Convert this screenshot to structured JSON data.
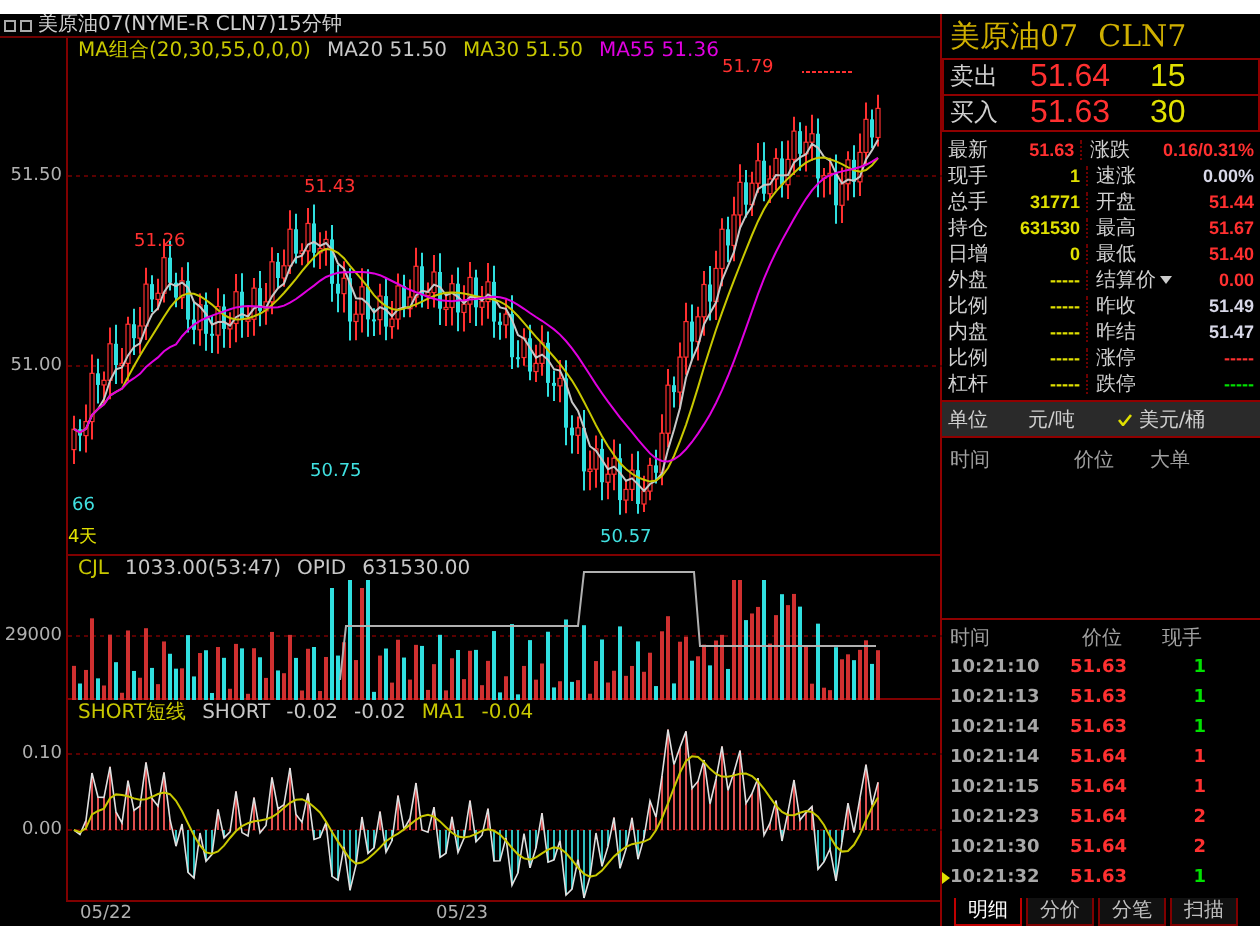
{
  "chart_header": {
    "title": "美原油07(NYME-R CLN7)15分钟"
  },
  "main_chart": {
    "legend": [
      {
        "text": "MA组合(20,30,55,0,0,0)",
        "color": "#c8c800"
      },
      {
        "text": "MA20 51.50",
        "color": "#c8c8c8"
      },
      {
        "text": "MA30 51.50",
        "color": "#c8c800"
      },
      {
        "text": "MA55 51.36",
        "color": "#e000e0"
      }
    ],
    "y_labels": [
      "51.50",
      "51.00"
    ],
    "price_marks": [
      {
        "text": "51.79",
        "color": "#ff3030"
      },
      {
        "text": "51.43",
        "color": "#ff3030"
      },
      {
        "text": "51.26",
        "color": "#ff3030"
      },
      {
        "text": "50.75",
        "color": "#40e0e0"
      },
      {
        "text": "50.57",
        "color": "#40e0e0"
      }
    ],
    "corner_labels": [
      {
        "text": "66",
        "color": "#40e0e0"
      },
      {
        "text": "4天",
        "color": "#e0e000"
      }
    ]
  },
  "volume_panel": {
    "legend": [
      {
        "text": "CJL",
        "color": "#c8c800"
      },
      {
        "text": "1033.00(53:47)",
        "color": "#c8c8c8"
      },
      {
        "text": "OPID",
        "color": "#c8c8c8"
      },
      {
        "text": "631530.00",
        "color": "#c8c8c8"
      }
    ],
    "y_labels": [
      "29000"
    ]
  },
  "short_panel": {
    "legend": [
      {
        "text": "SHORT短线",
        "color": "#c8c800"
      },
      {
        "text": "SHORT",
        "color": "#c8c8c8"
      },
      {
        "text": "-0.02",
        "color": "#c8c8c8"
      },
      {
        "text": "-0.02",
        "color": "#c8c8c8"
      },
      {
        "text": "MA1",
        "color": "#c8c800"
      },
      {
        "text": "-0.04",
        "color": "#c8c800"
      }
    ],
    "y_labels": [
      "0.10",
      "0.00"
    ]
  },
  "x_labels": [
    "05/22",
    "05/23"
  ],
  "quote": {
    "name": "美原油07",
    "code": "CLN7",
    "book": [
      {
        "label": "卖出",
        "price": "51.64",
        "volume": "15"
      },
      {
        "label": "买入",
        "price": "51.63",
        "volume": "30"
      }
    ],
    "stats": [
      {
        "left": {
          "label": "最新",
          "value": "51.63",
          "color": "#ff3030"
        },
        "right": {
          "label": "涨跌",
          "value": "0.16/0.31%",
          "color": "#ff3030",
          "dropdown": false
        }
      },
      {
        "left": {
          "label": "现手",
          "value": "1",
          "color": "#e0e000"
        },
        "right": {
          "label": "速涨",
          "value": "0.00%",
          "color": "#d8d8e8",
          "dropdown": false
        }
      },
      {
        "left": {
          "label": "总手",
          "value": "31771",
          "color": "#e0e000"
        },
        "right": {
          "label": "开盘",
          "value": "51.44",
          "color": "#ff3030",
          "dropdown": false
        }
      },
      {
        "left": {
          "label": "持仓",
          "value": "631530",
          "color": "#e0e000"
        },
        "right": {
          "label": "最高",
          "value": "51.67",
          "color": "#ff3030",
          "dropdown": false
        }
      },
      {
        "left": {
          "label": "日增",
          "value": "0",
          "color": "#e0e000"
        },
        "right": {
          "label": "最低",
          "value": "51.40",
          "color": "#ff3030",
          "dropdown": false
        }
      },
      {
        "left": {
          "label": "外盘",
          "value": "-----",
          "color": "#e0e000"
        },
        "right": {
          "label": "结算价",
          "value": "0.00",
          "color": "#ff3030",
          "dropdown": true
        }
      },
      {
        "left": {
          "label": "比例",
          "value": "-----",
          "color": "#e0e000"
        },
        "right": {
          "label": "昨收",
          "value": "51.49",
          "color": "#d8d8e8",
          "dropdown": false
        }
      },
      {
        "left": {
          "label": "内盘",
          "value": "-----",
          "color": "#e0e000"
        },
        "right": {
          "label": "昨结",
          "value": "51.47",
          "color": "#d8d8e8",
          "dropdown": false
        }
      },
      {
        "left": {
          "label": "比例",
          "value": "-----",
          "color": "#e0e000"
        },
        "right": {
          "label": "涨停",
          "value": "-----",
          "color": "#ff3030",
          "dropdown": false
        }
      },
      {
        "left": {
          "label": "杠杆",
          "value": "-----",
          "color": "#e0e000"
        },
        "right": {
          "label": "跌停",
          "value": "-----",
          "color": "#00e000",
          "dropdown": false
        }
      }
    ],
    "unit": {
      "label": "单位",
      "options": [
        {
          "label": "元/吨",
          "checked": false
        },
        {
          "label": "美元/桶",
          "checked": true
        }
      ]
    },
    "big_orders": {
      "columns": [
        "时间",
        "价位",
        "大单"
      ]
    },
    "trades": {
      "columns": [
        "时间",
        "价位",
        "现手"
      ],
      "rows": [
        {
          "time": "10:21:10",
          "price": "51.63",
          "lots": "1",
          "color": "#00e000",
          "current": false
        },
        {
          "time": "10:21:13",
          "price": "51.63",
          "lots": "1",
          "color": "#00e000",
          "current": false
        },
        {
          "time": "10:21:14",
          "price": "51.63",
          "lots": "1",
          "color": "#00e000",
          "current": false
        },
        {
          "time": "10:21:14",
          "price": "51.64",
          "lots": "1",
          "color": "#ff3030",
          "current": false
        },
        {
          "time": "10:21:15",
          "price": "51.64",
          "lots": "1",
          "color": "#ff3030",
          "current": false
        },
        {
          "time": "10:21:23",
          "price": "51.64",
          "lots": "2",
          "color": "#ff3030",
          "current": false
        },
        {
          "time": "10:21:30",
          "price": "51.64",
          "lots": "2",
          "color": "#ff3030",
          "current": false
        },
        {
          "time": "10:21:32",
          "price": "51.63",
          "lots": "1",
          "color": "#00e000",
          "current": true
        }
      ]
    },
    "tabs": [
      {
        "label": "明细",
        "selected": true
      },
      {
        "label": "分价",
        "selected": false
      },
      {
        "label": "分笔",
        "selected": false
      },
      {
        "label": "扫描",
        "selected": false
      }
    ]
  }
}
